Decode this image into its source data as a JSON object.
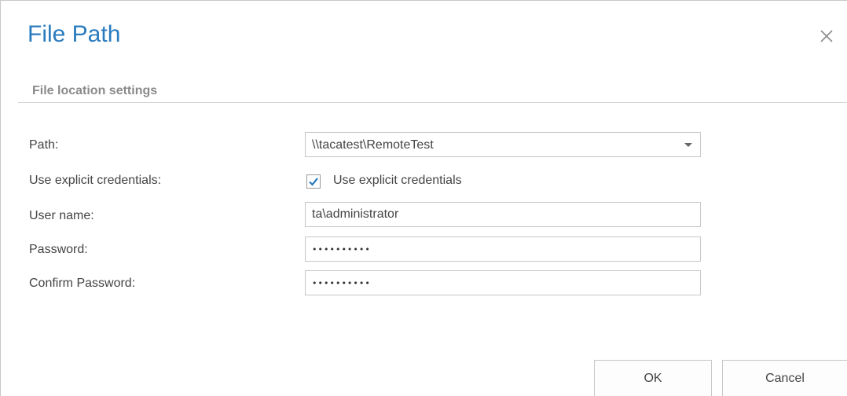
{
  "dialog": {
    "title": "File Path",
    "close_icon": "close-icon"
  },
  "section": {
    "header": "File location settings"
  },
  "form": {
    "path": {
      "label": "Path:",
      "value": "\\\\tacatest\\RemoteTest",
      "dropdown_icon": "chevron-down-icon"
    },
    "explicit_credentials": {
      "label": "Use explicit credentials:",
      "checkbox_label": "Use explicit credentials",
      "checked": true
    },
    "user_name": {
      "label": "User name:",
      "value": "ta\\administrator"
    },
    "password": {
      "label": "Password:",
      "masked_value": "••••••••••"
    },
    "confirm_password": {
      "label": "Confirm Password:",
      "masked_value": "••••••••••"
    }
  },
  "buttons": {
    "ok": "OK",
    "cancel": "Cancel"
  },
  "colors": {
    "title": "#2b7bbf",
    "checkmark": "#2b7bbf",
    "section_header": "#8a8a8a",
    "border": "#c6c6c6"
  }
}
